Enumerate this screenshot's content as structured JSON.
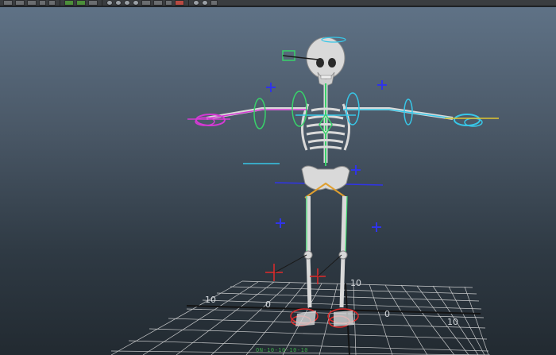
{
  "toolbar": {
    "icons": [
      "new-scene-icon",
      "open-scene-icon",
      "save-scene-icon",
      "undo-icon",
      "redo-icon",
      "select-tool-icon",
      "lasso-icon",
      "paint-select-icon",
      "snap-grid-icon",
      "snap-curve-icon",
      "snap-point-icon",
      "snap-surface-icon",
      "history-icon",
      "render-icon",
      "ipr-icon",
      "render-settings-icon",
      "hypershade-icon",
      "ik-handle-icon",
      "joint-tool-icon"
    ]
  },
  "viewport": {
    "subject": "skeleton-rig",
    "grid_labels": {
      "left": "10",
      "front": "10",
      "right": "10",
      "minus_z": "0",
      "back": "0"
    },
    "status_text": "ON-10-10-10-10"
  },
  "colors": {
    "background_top": "#5f7286",
    "background_bottom": "#222a31",
    "bone": "#d9d9d9",
    "ctrl_cyan": "#37c7e8",
    "ctrl_magenta": "#d43ad4",
    "ctrl_green": "#38d26a",
    "ctrl_blue": "#3034e8",
    "ctrl_red": "#e02a2a",
    "ctrl_yellow": "#e0c630",
    "grid": "#e8e8e8",
    "axis": "#1a1a1a"
  }
}
